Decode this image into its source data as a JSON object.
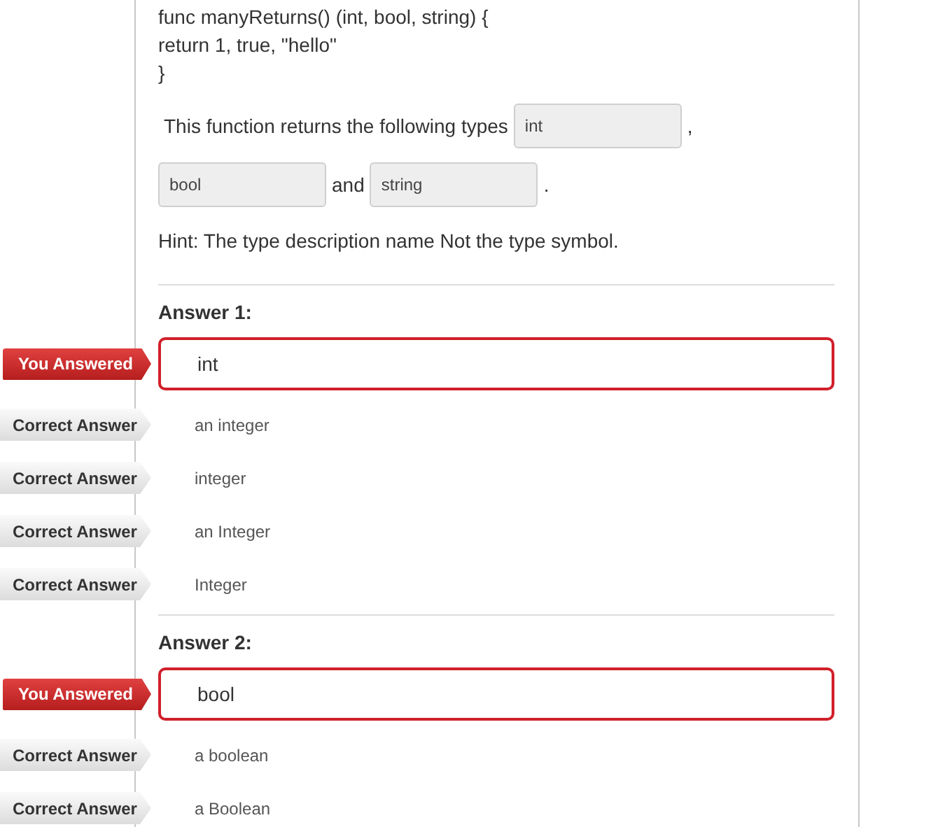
{
  "question": {
    "code": [
      "func manyReturns() (int, bool, string) {",
      "return 1, true, \"hello\"",
      "}"
    ],
    "sentence": [
      {
        "kind": "text",
        "text": "This function returns the following types"
      },
      {
        "kind": "blank",
        "value": "int"
      },
      {
        "kind": "text",
        "text": ","
      },
      {
        "kind": "break"
      },
      {
        "kind": "blank",
        "value": "bool"
      },
      {
        "kind": "text",
        "text": "and"
      },
      {
        "kind": "blank",
        "value": "string"
      },
      {
        "kind": "text",
        "text": "."
      }
    ],
    "hint": "Hint: The type description name Not the type symbol."
  },
  "answers": [
    {
      "title": "Answer 1:",
      "response": {
        "tag": "You Answered",
        "value": "int"
      },
      "correct": [
        {
          "tag": "Correct Answer",
          "value": "an integer"
        },
        {
          "tag": "Correct Answer",
          "value": "integer"
        },
        {
          "tag": "Correct Answer",
          "value": "an Integer"
        },
        {
          "tag": "Correct Answer",
          "value": "Integer"
        }
      ]
    },
    {
      "title": "Answer 2:",
      "response": {
        "tag": "You Answered",
        "value": "bool"
      },
      "correct": [
        {
          "tag": "Correct Answer",
          "value": "a boolean"
        },
        {
          "tag": "Correct Answer",
          "value": "a Boolean"
        }
      ]
    }
  ]
}
